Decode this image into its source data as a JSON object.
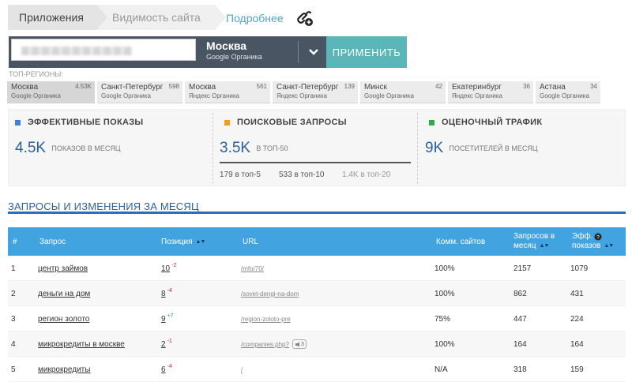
{
  "breadcrumbs": [
    "Приложения",
    "Видимость сайта"
  ],
  "more_link": "Подробнее",
  "search": {
    "region_name": "Москва",
    "region_sub": "Google Органика",
    "apply_label": "ПРИМЕНИТЬ"
  },
  "top_regions": {
    "label": "ТОП-РЕГИОНЫ:",
    "items": [
      {
        "name": "Москва",
        "sub": "Google Органика",
        "count": "4.53K",
        "active": true
      },
      {
        "name": "Санкт-Петербург",
        "sub": "Google Органика",
        "count": "598"
      },
      {
        "name": "Москва",
        "sub": "Яндекс Органика",
        "count": "561"
      },
      {
        "name": "Санкт-Петербург",
        "sub": "Яндекс Органика",
        "count": "139"
      },
      {
        "name": "Минск",
        "sub": "Google Органика",
        "count": "42"
      },
      {
        "name": "Екатеринбург",
        "sub": "Яндекс Органика",
        "count": "36"
      },
      {
        "name": "Астана",
        "sub": "Google Органика",
        "count": "34"
      }
    ]
  },
  "metrics": {
    "impressions": {
      "title": "ЭФФЕКТИВНЫЕ ПОКАЗЫ",
      "value": "4.5K",
      "sub": "ПОКАЗОВ В МЕСЯЦ",
      "color": "#3f7fd8"
    },
    "queries": {
      "title": "ПОИСКОВЫЕ ЗАПРОСЫ",
      "value": "3.5K",
      "sub": "В ТОП-50",
      "color": "#f0a01e",
      "top5": "179 в топ-5",
      "top10": "533 в топ-10",
      "top20": "1.4K в топ-20"
    },
    "traffic": {
      "title": "ОЦЕНОЧНЫЙ ТРАФИК",
      "value": "9K",
      "sub": "ПОСЕТИТЕЛЕЙ В МЕСЯЦ",
      "color": "#2eaa4a"
    }
  },
  "section_title": "ЗАПРОСЫ И ИЗМЕНЕНИЯ ЗА МЕСЯЦ",
  "table": {
    "headers": {
      "num": "#",
      "query": "Запрос",
      "position": "Позиция",
      "url": "URL",
      "comm": "Комм. сайтов",
      "requests_1": "Запросов в",
      "requests_2": "месяц",
      "eff_1": "Эфф.",
      "eff_2": "показов"
    },
    "rows": [
      {
        "n": "1",
        "query": "центр займов",
        "pos": "10",
        "delta": "-2",
        "dir": "down",
        "url": "/mfo/70/",
        "comm": "100%",
        "req": "2157",
        "eff": "1079"
      },
      {
        "n": "2",
        "query": "деньги на дом",
        "pos": "8",
        "delta": "-4",
        "dir": "down",
        "url": "/sovet-dengi-na-dom",
        "comm": "100%",
        "req": "862",
        "eff": "431"
      },
      {
        "n": "3",
        "query": "регион золото",
        "pos": "9",
        "delta": "+7",
        "dir": "up",
        "url": "/region-zoloto-pre",
        "comm": "75%",
        "req": "447",
        "eff": "224"
      },
      {
        "n": "4",
        "query": "микрокредиты в москве",
        "pos": "2",
        "delta": "-1",
        "dir": "down",
        "url": "/companies.php?",
        "badge": "3",
        "comm": "100%",
        "req": "164",
        "eff": "164"
      },
      {
        "n": "5",
        "query": "микрокредиты",
        "pos": "6",
        "delta": "-4",
        "dir": "down",
        "url": "/",
        "comm": "N/A",
        "req": "318",
        "eff": "159"
      }
    ]
  }
}
